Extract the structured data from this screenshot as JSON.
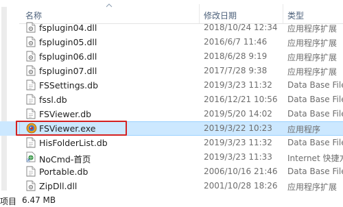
{
  "header": {
    "name_label": "名称",
    "date_label": "修改日期",
    "type_label": "类型"
  },
  "files": [
    {
      "name": "fsplugin04.dll",
      "date": "2018/10/24 12:34",
      "type": "应用程序扩展",
      "icon": "dll-icon"
    },
    {
      "name": "fsplugin05.dll",
      "date": "2016/6/7 11:46",
      "type": "应用程序扩展",
      "icon": "dll-icon"
    },
    {
      "name": "fsplugin06.dll",
      "date": "2018/6/28 9:19",
      "type": "应用程序扩展",
      "icon": "dll-icon"
    },
    {
      "name": "fsplugin07.dll",
      "date": "2017/7/28 9:38",
      "type": "应用程序扩展",
      "icon": "dll-icon"
    },
    {
      "name": "FSSettings.db",
      "date": "2019/3/23 11:32",
      "type": "Data Base File",
      "icon": "db-file-icon"
    },
    {
      "name": "fssl.db",
      "date": "2016/12/21 10:56",
      "type": "Data Base File",
      "icon": "db-file-icon"
    },
    {
      "name": "FSViewer.db",
      "date": "2019/5/20 14:02",
      "type": "Data Base File",
      "icon": "db-file-icon"
    },
    {
      "name": "FSViewer.exe",
      "date": "2019/3/22 10:23",
      "type": "应用程序",
      "icon": "fsviewer-app-icon",
      "selected": true
    },
    {
      "name": "HisFolderList.db",
      "date": "2019/3/23 11:32",
      "type": "Data Base File",
      "icon": "db-file-icon"
    },
    {
      "name": "NoCmd-首页",
      "date": "2019/3/23 11:33",
      "type": "Internet 快捷方",
      "icon": "internet-shortcut-icon"
    },
    {
      "name": "Portable.db",
      "date": "2006/10/16 21:46",
      "type": "Data Base File",
      "icon": "db-file-icon"
    },
    {
      "name": "ZipDll.dll",
      "date": "2001/10/28 18:26",
      "type": "应用程序扩展",
      "icon": "dll-icon"
    }
  ],
  "status": {
    "items_label": "项目",
    "selected_size": "6.47 MB"
  },
  "colors": {
    "selection": "#cce8ff",
    "highlight_box": "#d42020",
    "header_text": "#4c607a"
  }
}
